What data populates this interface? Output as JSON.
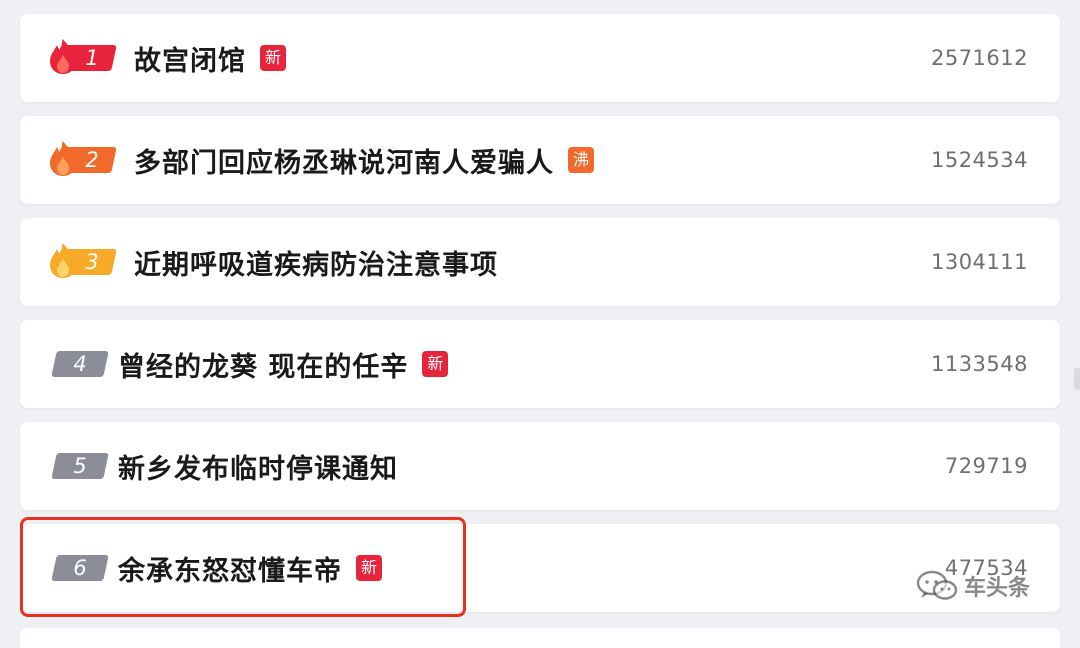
{
  "hot_list": [
    {
      "rank": "1",
      "title": "故宫闭馆",
      "badge": "新",
      "count": "2571612"
    },
    {
      "rank": "2",
      "title": "多部门回应杨丞琳说河南人爱骗人",
      "badge": "沸",
      "count": "1524534"
    },
    {
      "rank": "3",
      "title": "近期呼吸道疾病防治注意事项",
      "badge": "",
      "count": "1304111"
    },
    {
      "rank": "4",
      "title": "曾经的龙葵 现在的任辛",
      "badge": "新",
      "count": "1133548"
    },
    {
      "rank": "5",
      "title": "新乡发布临时停课通知",
      "badge": "",
      "count": "729719"
    },
    {
      "rank": "6",
      "title": "余承东怒怼懂车帝",
      "badge": "新",
      "count": "477534"
    }
  ],
  "watermark": {
    "text": "车头条",
    "icon": "wechat-icon"
  },
  "colors": {
    "rank_1": "#e8243c",
    "rank_2": "#f26a2b",
    "rank_3": "#f7a928",
    "rank_other": "#8b8d99",
    "badge_new": "#e8243c",
    "badge_hot": "#f26a2b",
    "highlight_box": "#e8321f"
  }
}
